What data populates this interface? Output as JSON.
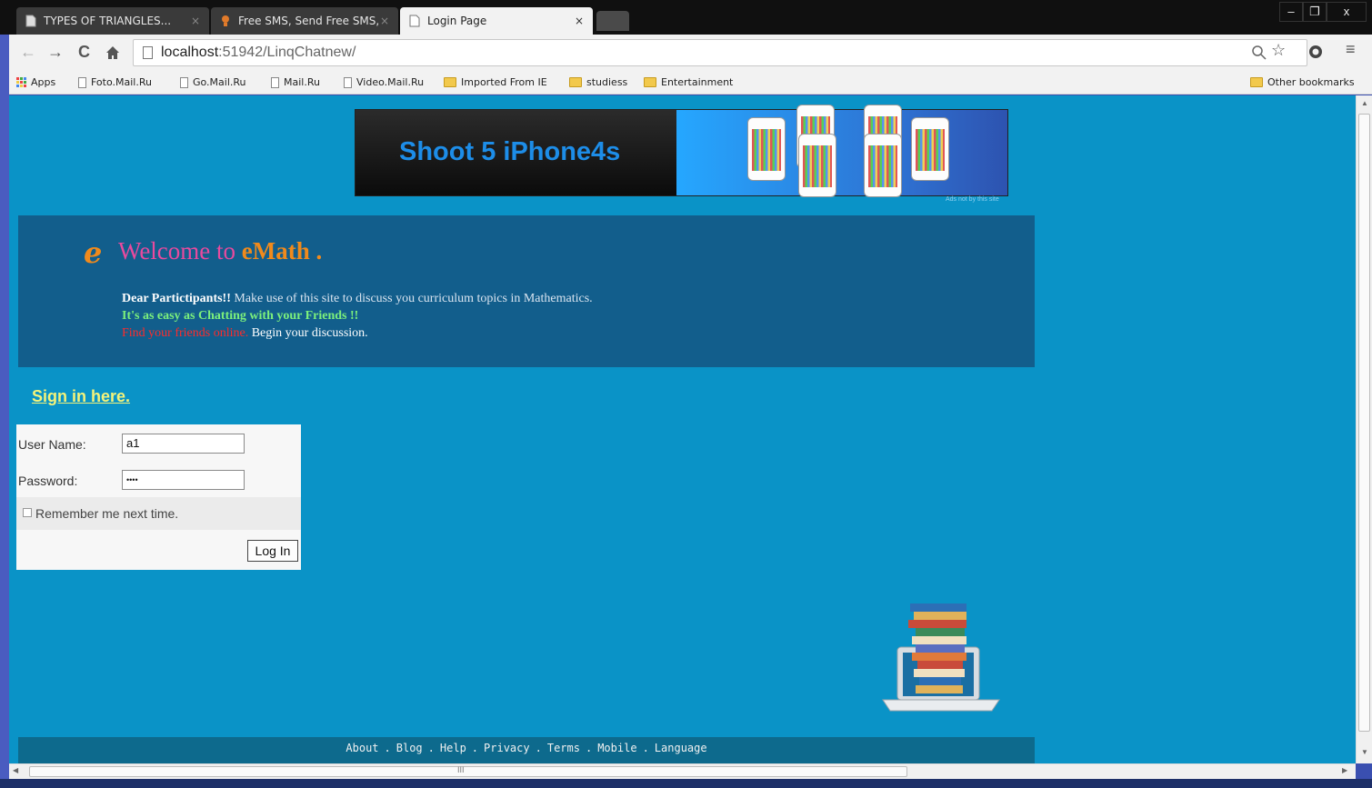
{
  "browser": {
    "tabs": [
      {
        "title": "TYPES OF TRIANGLES..."
      },
      {
        "title": "Free SMS, Send Free SMS,"
      },
      {
        "title": "Login Page"
      }
    ],
    "url_host": "localhost",
    "url_rest": ":51942/LinqChatnew/",
    "bookmarks": [
      {
        "label": "Apps",
        "icon": "apps-icon"
      },
      {
        "label": "Foto.Mail.Ru",
        "icon": "page-icon"
      },
      {
        "label": "Go.Mail.Ru",
        "icon": "page-icon"
      },
      {
        "label": "Mail.Ru",
        "icon": "page-icon"
      },
      {
        "label": "Video.Mail.Ru",
        "icon": "page-icon"
      },
      {
        "label": "Imported From IE",
        "icon": "folder-icon"
      },
      {
        "label": "studiess",
        "icon": "folder-icon"
      },
      {
        "label": "Entertainment",
        "icon": "folder-icon"
      }
    ],
    "other_bookmarks": "Other bookmarks",
    "hscroll_grip": "III"
  },
  "ad": {
    "headline": "Shoot 5 iPhone4s",
    "note": "Ads not by this site"
  },
  "welcome": {
    "logo": "e",
    "title_prefix": "Welcome to ",
    "brand": "eMath .",
    "line1_bold": "Dear Partictipants!!",
    "line1_rest": "  Make use of this site to discuss you curriculum topics in Mathematics.",
    "line2": "It's as easy as Chatting with your Friends !!",
    "line3_red": "Find your friends online.",
    "line3_white": " Begin your discussion."
  },
  "signin": {
    "link": "Sign in here."
  },
  "login": {
    "username_label": "User Name:",
    "username_value": "a1",
    "password_label": "Password:",
    "password_value": "••••",
    "remember_label": "Remember me next time.",
    "submit_label": "Log In"
  },
  "footer": {
    "links": [
      "About",
      "Blog",
      "Help",
      "Privacy",
      "Terms",
      "Mobile",
      "Language"
    ],
    "separator": "."
  },
  "colors": {
    "page_bg": "#0a93c7",
    "panel_bg": "#125e8c",
    "footer_bg": "#0d6a8d",
    "brand_orange": "#f08a1c",
    "signin_yellow": "#f4f37a"
  }
}
